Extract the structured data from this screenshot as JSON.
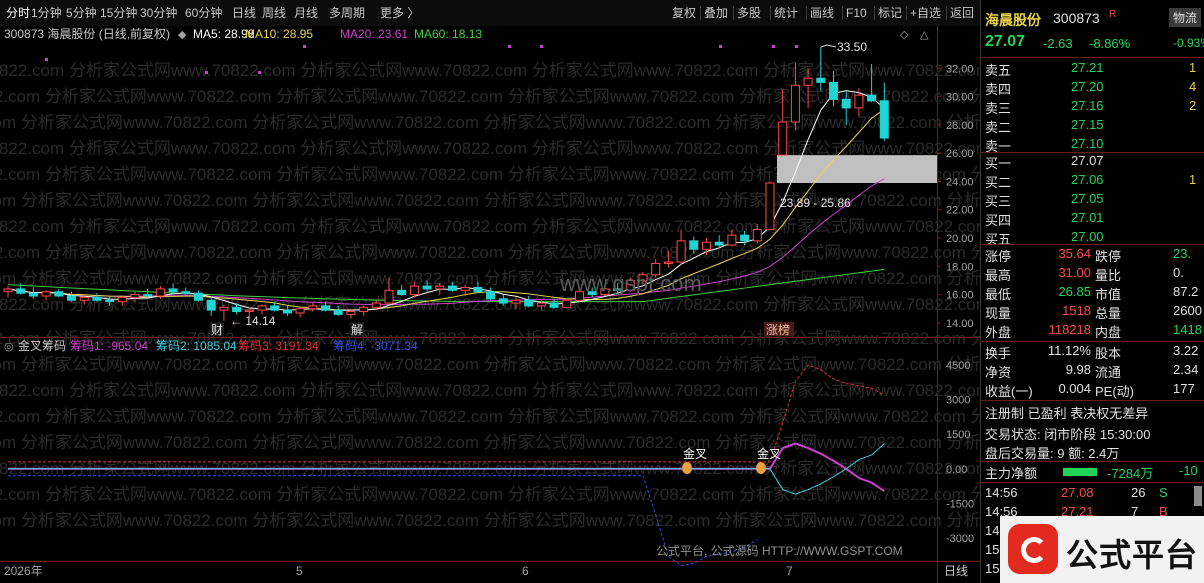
{
  "toolbar": {
    "left": [
      "分时",
      "1分钟",
      "5分钟",
      "15分钟",
      "30分钟",
      "60分钟",
      "日线",
      "周线",
      "月线",
      "多周期",
      "更多 〉"
    ],
    "right": [
      "复权",
      "叠加",
      "多股",
      "统计",
      "画线",
      "F10",
      "标记",
      "+自选",
      "返回"
    ]
  },
  "kline_header": {
    "code_name": "300873 海晨股份 (日线,前复权)",
    "ma5": "MA5: 28.98",
    "ma10": "MA10: 28.95",
    "ma20": "MA20: 23.61",
    "ma60": "MA60: 18.13"
  },
  "indicator_header": {
    "name": "金叉筹码",
    "c1": "筹码1: -965.04",
    "c2": "筹码2: 1085.04",
    "c3": "筹码3: 3191.34",
    "c4": "筹码4: -3071.34"
  },
  "kline_axis": [
    "32.00",
    "30.00",
    "28.00",
    "26.00",
    "24.00",
    "22.00",
    "20.00",
    "18.00",
    "16.00",
    "14.00"
  ],
  "indicator_axis": [
    "4500",
    "3000",
    "1500",
    "0.00",
    "-1500",
    "-3000"
  ],
  "annotations": {
    "high": "33.50",
    "low": "14.14",
    "gap": "23.89 - 25.86",
    "cai": "财",
    "jie": "解",
    "zhangbang": "涨榜",
    "jincha": "金叉"
  },
  "x_axis": {
    "year": "2026年",
    "m5": "5",
    "m6": "6",
    "m7": "7",
    "period": "日线"
  },
  "watermark": {
    "row": "70822.com 分析家公式网www.70822.com 分析家公式网www.70822.com 分析家公式网www.70822.com 分析家公式网www.70822.com 分析家公式网www.70822",
    "gspt": "www.gspt.com",
    "footer": "公式平台, 公式源码 HTTP://WWW.GSPT.COM"
  },
  "quote": {
    "name": "海晨股份",
    "code": "300873",
    "r_badge": "R",
    "wuliu": "物流",
    "price": "27.07",
    "change": "-2.63",
    "pct": "-8.86%",
    "extra": "-0.93%"
  },
  "order_book": {
    "asks": [
      {
        "label": "卖五",
        "price": "27.21",
        "vol": "1"
      },
      {
        "label": "卖四",
        "price": "27.20",
        "vol": "4"
      },
      {
        "label": "卖三",
        "price": "27.16",
        "vol": "2"
      },
      {
        "label": "卖二",
        "price": "27.15",
        "vol": ""
      },
      {
        "label": "卖一",
        "price": "27.10",
        "vol": ""
      }
    ],
    "bids": [
      {
        "label": "买一",
        "price": "27.07",
        "vol": ""
      },
      {
        "label": "买二",
        "price": "27.06",
        "vol": "1"
      },
      {
        "label": "买三",
        "price": "27.05",
        "vol": ""
      },
      {
        "label": "买四",
        "price": "27.01",
        "vol": ""
      },
      {
        "label": "买五",
        "price": "27.00",
        "vol": ""
      }
    ]
  },
  "stats": [
    {
      "l1": "涨停",
      "v1": "35.64",
      "c1": "up",
      "l2": "跌停",
      "v2": "23.",
      "c2": "dn"
    },
    {
      "l1": "最高",
      "v1": "31.00",
      "c1": "up",
      "l2": "量比",
      "v2": "0.",
      "c2": "wh"
    },
    {
      "l1": "最低",
      "v1": "26.85",
      "c1": "dn",
      "l2": "市值",
      "v2": "87.2",
      "c2": "wh"
    },
    {
      "l1": "现量",
      "v1": "1518",
      "c1": "up",
      "l2": "总量",
      "v2": "2600",
      "c2": "wh"
    },
    {
      "l1": "外盘",
      "v1": "118218",
      "c1": "up",
      "l2": "内盘",
      "v2": "1418",
      "c2": "dn"
    }
  ],
  "stats2": [
    {
      "l1": "换手",
      "v1": "11.12%",
      "l2": "股本",
      "v2": "3.22"
    },
    {
      "l1": "净资",
      "v1": "9.98",
      "l2": "流通",
      "v2": "2.34"
    },
    {
      "l1": "收益(一)",
      "v1": "0.004",
      "l2": "PE(动)",
      "v2": "177"
    }
  ],
  "info": {
    "tags": "注册制 已盈利 表决权无差异",
    "status": "交易状态: 闭市阶段 15:30:00",
    "after": "盘后交易量: 9  额: 2.4万",
    "mainflow_label": "主力净额",
    "mainflow_value": "-7284万",
    "mainflow_tail": "-10"
  },
  "ticks": [
    {
      "time": "14:56",
      "price": "27.08",
      "vol": "26",
      "side": "S"
    },
    {
      "time": "14:56",
      "price": "27.21",
      "vol": "7",
      "side": "B"
    },
    {
      "time": "14:",
      "price": "",
      "vol": "",
      "side": ""
    },
    {
      "time": "15:",
      "price": "",
      "vol": "",
      "side": ""
    },
    {
      "time": "15:",
      "price": "",
      "vol": "",
      "side": ""
    }
  ],
  "brand": {
    "text": "公式平台"
  },
  "colors": {
    "up": "#ff4a4a",
    "down": "#22d3d3",
    "ma5": "#ffffff",
    "ma10": "#e8d44a",
    "ma20": "#d040d0",
    "ma60": "#40d040"
  },
  "chart_data": [
    {
      "type": "candlestick",
      "title": "300873 海晨股份 (日线,前复权)",
      "ylim": [
        13,
        34
      ],
      "ohlc": [
        [
          16.2,
          16.6,
          15.8,
          16.4
        ],
        [
          16.4,
          16.8,
          16.0,
          16.1
        ],
        [
          16.1,
          16.5,
          15.7,
          15.9
        ],
        [
          15.9,
          16.3,
          15.6,
          16.2
        ],
        [
          16.2,
          16.4,
          15.8,
          15.9
        ],
        [
          15.9,
          16.2,
          15.5,
          15.6
        ],
        [
          15.6,
          16.0,
          15.3,
          15.8
        ],
        [
          15.8,
          16.1,
          15.5,
          15.6
        ],
        [
          15.6,
          15.9,
          15.2,
          15.5
        ],
        [
          15.5,
          15.9,
          15.2,
          15.8
        ],
        [
          15.8,
          16.2,
          15.5,
          16.0
        ],
        [
          16.0,
          16.4,
          15.7,
          15.9
        ],
        [
          15.9,
          16.6,
          15.7,
          16.4
        ],
        [
          16.4,
          16.8,
          16.0,
          16.2
        ],
        [
          16.2,
          16.5,
          15.9,
          16.1
        ],
        [
          16.1,
          16.3,
          15.5,
          15.6
        ],
        [
          15.6,
          15.9,
          14.5,
          14.9
        ],
        [
          14.9,
          15.3,
          14.14,
          15.1
        ],
        [
          15.1,
          15.4,
          14.6,
          14.8
        ],
        [
          14.8,
          15.1,
          14.4,
          14.9
        ],
        [
          14.9,
          15.3,
          14.6,
          15.2
        ],
        [
          15.2,
          15.5,
          14.8,
          14.9
        ],
        [
          14.9,
          15.2,
          14.5,
          14.7
        ],
        [
          14.7,
          15.1,
          14.4,
          15.0
        ],
        [
          15.0,
          15.4,
          14.8,
          15.2
        ],
        [
          15.2,
          15.5,
          14.8,
          14.9
        ],
        [
          14.9,
          15.2,
          14.5,
          14.6
        ],
        [
          14.6,
          15.0,
          14.3,
          14.8
        ],
        [
          14.8,
          15.2,
          14.5,
          15.1
        ],
        [
          15.1,
          15.6,
          14.9,
          15.4
        ],
        [
          15.4,
          17.2,
          15.3,
          16.3
        ],
        [
          16.3,
          16.7,
          15.9,
          16.0
        ],
        [
          16.0,
          16.9,
          15.8,
          16.6
        ],
        [
          16.6,
          17.0,
          16.2,
          16.4
        ],
        [
          16.4,
          16.8,
          16.0,
          16.6
        ],
        [
          16.6,
          16.9,
          16.2,
          16.3
        ],
        [
          16.3,
          16.7,
          15.9,
          16.5
        ],
        [
          16.5,
          16.9,
          16.1,
          16.2
        ],
        [
          16.2,
          16.5,
          15.6,
          15.7
        ],
        [
          15.7,
          16.0,
          15.2,
          15.4
        ],
        [
          15.4,
          15.8,
          15.0,
          15.6
        ],
        [
          15.6,
          15.9,
          15.1,
          15.2
        ],
        [
          15.2,
          15.6,
          14.9,
          15.4
        ],
        [
          15.4,
          15.7,
          15.0,
          15.1
        ],
        [
          15.1,
          15.7,
          15.0,
          15.6
        ],
        [
          15.6,
          16.4,
          15.5,
          16.2
        ],
        [
          16.2,
          16.5,
          15.8,
          16.0
        ],
        [
          16.0,
          16.6,
          15.9,
          16.4
        ],
        [
          16.4,
          16.8,
          16.1,
          16.3
        ],
        [
          16.3,
          17.2,
          16.2,
          17.0
        ],
        [
          17.0,
          17.6,
          16.7,
          17.4
        ],
        [
          17.4,
          18.5,
          17.2,
          18.2
        ],
        [
          18.2,
          19.1,
          17.9,
          18.3
        ],
        [
          18.3,
          20.6,
          18.1,
          19.8
        ],
        [
          19.8,
          20.1,
          18.9,
          19.2
        ],
        [
          19.2,
          20.0,
          18.8,
          19.7
        ],
        [
          19.7,
          20.2,
          19.3,
          19.5
        ],
        [
          19.5,
          20.6,
          19.4,
          20.2
        ],
        [
          20.2,
          20.5,
          19.5,
          19.8
        ],
        [
          19.8,
          21.0,
          19.6,
          20.6
        ],
        [
          20.6,
          24.0,
          20.5,
          23.89
        ],
        [
          25.86,
          30.5,
          25.86,
          28.2
        ],
        [
          28.2,
          32.4,
          27.6,
          30.8
        ],
        [
          30.8,
          32.0,
          29.2,
          31.3
        ],
        [
          31.3,
          33.5,
          30.4,
          31.0
        ],
        [
          31.0,
          31.8,
          29.3,
          29.8
        ],
        [
          29.8,
          30.4,
          28.0,
          29.2
        ],
        [
          29.2,
          30.6,
          28.6,
          30.1
        ],
        [
          30.1,
          32.3,
          29.6,
          29.7
        ],
        [
          29.7,
          31.0,
          26.85,
          27.07
        ]
      ]
    },
    {
      "type": "line",
      "title": "金叉筹码",
      "ylim": [
        -4000,
        5500
      ],
      "series": [
        {
          "name": "筹码1",
          "color": "#d040d0",
          "values": [
            0,
            0,
            0,
            0,
            0,
            0,
            0,
            0,
            0,
            0,
            0,
            0,
            0,
            0,
            0,
            0,
            0,
            0,
            0,
            0,
            0,
            0,
            0,
            0,
            0,
            0,
            0,
            0,
            0,
            0,
            0,
            0,
            0,
            0,
            0,
            0,
            0,
            0,
            0,
            0,
            0,
            0,
            0,
            0,
            0,
            0,
            0,
            0,
            0,
            0,
            0,
            0,
            0,
            0,
            0,
            0,
            0,
            0,
            0,
            0,
            0,
            900,
            1100,
            900,
            650,
            350,
            0,
            -400,
            -600,
            -965
          ]
        },
        {
          "name": "筹码2",
          "color": "#40d0e0",
          "values": [
            0,
            0,
            0,
            0,
            0,
            0,
            0,
            0,
            0,
            0,
            0,
            0,
            0,
            0,
            0,
            0,
            0,
            0,
            0,
            0,
            0,
            0,
            0,
            0,
            0,
            0,
            0,
            0,
            0,
            0,
            0,
            0,
            0,
            0,
            0,
            0,
            0,
            0,
            0,
            0,
            0,
            0,
            0,
            0,
            0,
            0,
            0,
            0,
            0,
            0,
            0,
            0,
            0,
            0,
            0,
            0,
            0,
            0,
            0,
            0,
            0,
            -900,
            -1100,
            -900,
            -650,
            -350,
            0,
            400,
            600,
            1085
          ]
        },
        {
          "name": "筹码3",
          "color": "#e03030",
          "values": [
            300,
            300,
            300,
            300,
            300,
            300,
            300,
            300,
            300,
            300,
            300,
            300,
            300,
            300,
            300,
            300,
            300,
            300,
            300,
            300,
            300,
            300,
            300,
            300,
            300,
            300,
            300,
            300,
            300,
            300,
            300,
            300,
            300,
            300,
            300,
            300,
            300,
            300,
            300,
            300,
            300,
            300,
            300,
            300,
            300,
            300,
            300,
            300,
            300,
            300,
            300,
            300,
            300,
            300,
            300,
            300,
            300,
            300,
            300,
            300,
            300,
            2000,
            3800,
            4500,
            4300,
            3900,
            3700,
            3600,
            3500,
            3191
          ]
        },
        {
          "name": "筹码4",
          "color": "#3050e0",
          "values": [
            -300,
            -300,
            -300,
            -300,
            -300,
            -300,
            -300,
            -300,
            -300,
            -300,
            -300,
            -300,
            -300,
            -300,
            -300,
            -300,
            -300,
            -300,
            -300,
            -300,
            -300,
            -300,
            -300,
            -300,
            -300,
            -300,
            -300,
            -300,
            -300,
            -300,
            -300,
            -300,
            -300,
            -300,
            -300,
            -300,
            -300,
            -300,
            -300,
            -300,
            -300,
            -300,
            -300,
            -300,
            -300,
            -300,
            -300,
            -300,
            -300,
            -300,
            -300,
            -2000,
            -3800,
            -4200,
            -4100,
            -3800,
            -3700,
            -3600,
            -3400,
            -3071
          ]
        }
      ]
    }
  ]
}
